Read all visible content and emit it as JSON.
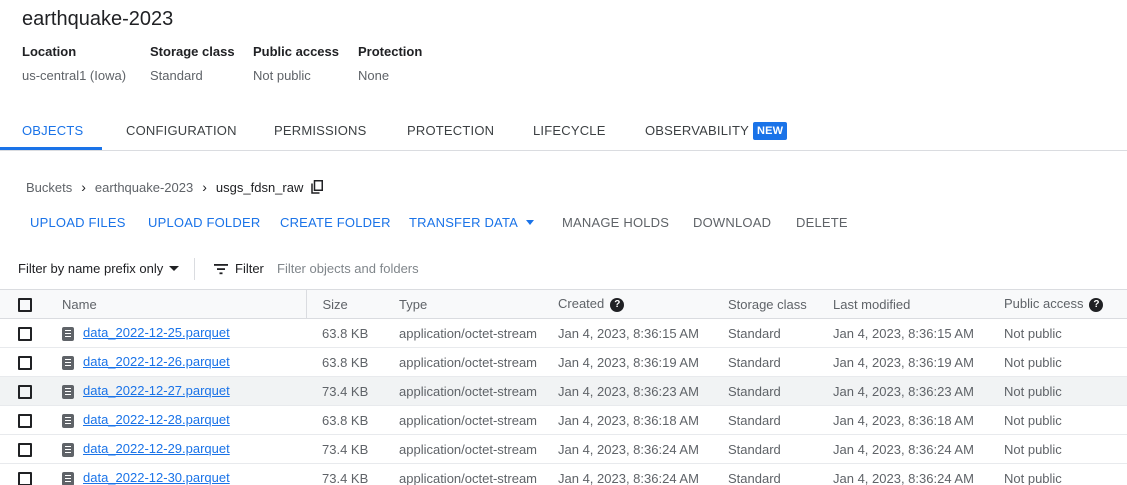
{
  "bucket": {
    "title": "earthquake-2023",
    "info": [
      {
        "label": "Location",
        "value": "us-central1 (Iowa)"
      },
      {
        "label": "Storage class",
        "value": "Standard"
      },
      {
        "label": "Public access",
        "value": "Not public"
      },
      {
        "label": "Protection",
        "value": "None"
      }
    ]
  },
  "tabs": [
    {
      "label": "OBJECTS",
      "active": true
    },
    {
      "label": "CONFIGURATION"
    },
    {
      "label": "PERMISSIONS"
    },
    {
      "label": "PROTECTION"
    },
    {
      "label": "LIFECYCLE"
    },
    {
      "label": "OBSERVABILITY",
      "badge": "NEW"
    }
  ],
  "breadcrumb": [
    "Buckets",
    "earthquake-2023",
    "usgs_fdsn_raw"
  ],
  "actions": {
    "upload_files": "UPLOAD FILES",
    "upload_folder": "UPLOAD FOLDER",
    "create_folder": "CREATE FOLDER",
    "transfer_data": "TRANSFER DATA",
    "manage_holds": "MANAGE HOLDS",
    "download": "DOWNLOAD",
    "delete": "DELETE"
  },
  "filter": {
    "mode": "Filter by name prefix only",
    "button": "Filter",
    "placeholder": "Filter objects and folders"
  },
  "table": {
    "columns": [
      "Name",
      "Size",
      "Type",
      "Created",
      "Storage class",
      "Last modified",
      "Public access"
    ],
    "rows": [
      {
        "name": "data_2022-12-25.parquet",
        "size": "63.8 KB",
        "type": "application/octet-stream",
        "created": "Jan 4, 2023, 8:36:15 AM",
        "storage_class": "Standard",
        "last_modified": "Jan 4, 2023, 8:36:15 AM",
        "public_access": "Not public"
      },
      {
        "name": "data_2022-12-26.parquet",
        "size": "63.8 KB",
        "type": "application/octet-stream",
        "created": "Jan 4, 2023, 8:36:19 AM",
        "storage_class": "Standard",
        "last_modified": "Jan 4, 2023, 8:36:19 AM",
        "public_access": "Not public"
      },
      {
        "name": "data_2022-12-27.parquet",
        "size": "73.4 KB",
        "type": "application/octet-stream",
        "created": "Jan 4, 2023, 8:36:23 AM",
        "storage_class": "Standard",
        "last_modified": "Jan 4, 2023, 8:36:23 AM",
        "public_access": "Not public"
      },
      {
        "name": "data_2022-12-28.parquet",
        "size": "63.8 KB",
        "type": "application/octet-stream",
        "created": "Jan 4, 2023, 8:36:18 AM",
        "storage_class": "Standard",
        "last_modified": "Jan 4, 2023, 8:36:18 AM",
        "public_access": "Not public"
      },
      {
        "name": "data_2022-12-29.parquet",
        "size": "73.4 KB",
        "type": "application/octet-stream",
        "created": "Jan 4, 2023, 8:36:24 AM",
        "storage_class": "Standard",
        "last_modified": "Jan 4, 2023, 8:36:24 AM",
        "public_access": "Not public"
      },
      {
        "name": "data_2022-12-30.parquet",
        "size": "73.4 KB",
        "type": "application/octet-stream",
        "created": "Jan 4, 2023, 8:36:24 AM",
        "storage_class": "Standard",
        "last_modified": "Jan 4, 2023, 8:36:24 AM",
        "public_access": "Not public"
      }
    ]
  }
}
